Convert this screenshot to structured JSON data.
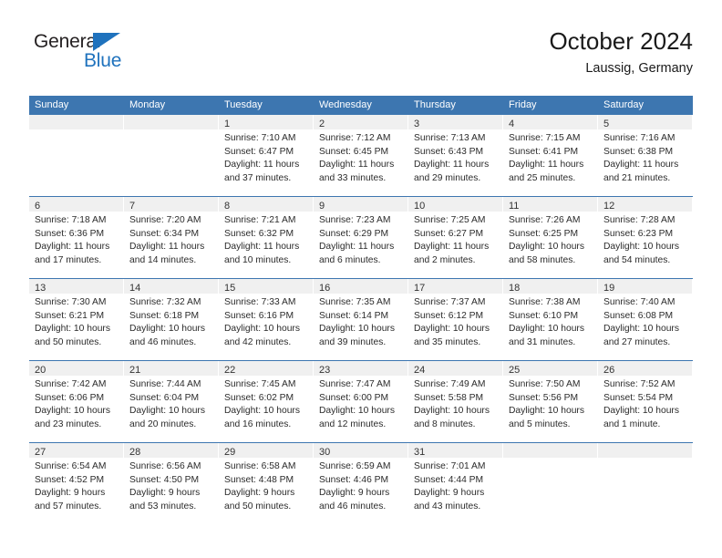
{
  "logo": {
    "word_top": "General",
    "word_bottom": "Blue",
    "triangle_color": "#1f72bd",
    "text_color": "#231f20"
  },
  "header": {
    "title": "October 2024",
    "subtitle": "Laussig, Germany"
  },
  "theme": {
    "header_bar": "#3d76b0",
    "num_band": "#f0f0f0",
    "text": "#2b2b2b"
  },
  "calendar": {
    "day_headers": [
      "Sunday",
      "Monday",
      "Tuesday",
      "Wednesday",
      "Thursday",
      "Friday",
      "Saturday"
    ],
    "weeks": [
      [
        {
          "day": "",
          "lines": []
        },
        {
          "day": "",
          "lines": []
        },
        {
          "day": "1",
          "lines": [
            "Sunrise: 7:10 AM",
            "Sunset: 6:47 PM",
            "Daylight: 11 hours",
            "and 37 minutes."
          ]
        },
        {
          "day": "2",
          "lines": [
            "Sunrise: 7:12 AM",
            "Sunset: 6:45 PM",
            "Daylight: 11 hours",
            "and 33 minutes."
          ]
        },
        {
          "day": "3",
          "lines": [
            "Sunrise: 7:13 AM",
            "Sunset: 6:43 PM",
            "Daylight: 11 hours",
            "and 29 minutes."
          ]
        },
        {
          "day": "4",
          "lines": [
            "Sunrise: 7:15 AM",
            "Sunset: 6:41 PM",
            "Daylight: 11 hours",
            "and 25 minutes."
          ]
        },
        {
          "day": "5",
          "lines": [
            "Sunrise: 7:16 AM",
            "Sunset: 6:38 PM",
            "Daylight: 11 hours",
            "and 21 minutes."
          ]
        }
      ],
      [
        {
          "day": "6",
          "lines": [
            "Sunrise: 7:18 AM",
            "Sunset: 6:36 PM",
            "Daylight: 11 hours",
            "and 17 minutes."
          ]
        },
        {
          "day": "7",
          "lines": [
            "Sunrise: 7:20 AM",
            "Sunset: 6:34 PM",
            "Daylight: 11 hours",
            "and 14 minutes."
          ]
        },
        {
          "day": "8",
          "lines": [
            "Sunrise: 7:21 AM",
            "Sunset: 6:32 PM",
            "Daylight: 11 hours",
            "and 10 minutes."
          ]
        },
        {
          "day": "9",
          "lines": [
            "Sunrise: 7:23 AM",
            "Sunset: 6:29 PM",
            "Daylight: 11 hours",
            "and 6 minutes."
          ]
        },
        {
          "day": "10",
          "lines": [
            "Sunrise: 7:25 AM",
            "Sunset: 6:27 PM",
            "Daylight: 11 hours",
            "and 2 minutes."
          ]
        },
        {
          "day": "11",
          "lines": [
            "Sunrise: 7:26 AM",
            "Sunset: 6:25 PM",
            "Daylight: 10 hours",
            "and 58 minutes."
          ]
        },
        {
          "day": "12",
          "lines": [
            "Sunrise: 7:28 AM",
            "Sunset: 6:23 PM",
            "Daylight: 10 hours",
            "and 54 minutes."
          ]
        }
      ],
      [
        {
          "day": "13",
          "lines": [
            "Sunrise: 7:30 AM",
            "Sunset: 6:21 PM",
            "Daylight: 10 hours",
            "and 50 minutes."
          ]
        },
        {
          "day": "14",
          "lines": [
            "Sunrise: 7:32 AM",
            "Sunset: 6:18 PM",
            "Daylight: 10 hours",
            "and 46 minutes."
          ]
        },
        {
          "day": "15",
          "lines": [
            "Sunrise: 7:33 AM",
            "Sunset: 6:16 PM",
            "Daylight: 10 hours",
            "and 42 minutes."
          ]
        },
        {
          "day": "16",
          "lines": [
            "Sunrise: 7:35 AM",
            "Sunset: 6:14 PM",
            "Daylight: 10 hours",
            "and 39 minutes."
          ]
        },
        {
          "day": "17",
          "lines": [
            "Sunrise: 7:37 AM",
            "Sunset: 6:12 PM",
            "Daylight: 10 hours",
            "and 35 minutes."
          ]
        },
        {
          "day": "18",
          "lines": [
            "Sunrise: 7:38 AM",
            "Sunset: 6:10 PM",
            "Daylight: 10 hours",
            "and 31 minutes."
          ]
        },
        {
          "day": "19",
          "lines": [
            "Sunrise: 7:40 AM",
            "Sunset: 6:08 PM",
            "Daylight: 10 hours",
            "and 27 minutes."
          ]
        }
      ],
      [
        {
          "day": "20",
          "lines": [
            "Sunrise: 7:42 AM",
            "Sunset: 6:06 PM",
            "Daylight: 10 hours",
            "and 23 minutes."
          ]
        },
        {
          "day": "21",
          "lines": [
            "Sunrise: 7:44 AM",
            "Sunset: 6:04 PM",
            "Daylight: 10 hours",
            "and 20 minutes."
          ]
        },
        {
          "day": "22",
          "lines": [
            "Sunrise: 7:45 AM",
            "Sunset: 6:02 PM",
            "Daylight: 10 hours",
            "and 16 minutes."
          ]
        },
        {
          "day": "23",
          "lines": [
            "Sunrise: 7:47 AM",
            "Sunset: 6:00 PM",
            "Daylight: 10 hours",
            "and 12 minutes."
          ]
        },
        {
          "day": "24",
          "lines": [
            "Sunrise: 7:49 AM",
            "Sunset: 5:58 PM",
            "Daylight: 10 hours",
            "and 8 minutes."
          ]
        },
        {
          "day": "25",
          "lines": [
            "Sunrise: 7:50 AM",
            "Sunset: 5:56 PM",
            "Daylight: 10 hours",
            "and 5 minutes."
          ]
        },
        {
          "day": "26",
          "lines": [
            "Sunrise: 7:52 AM",
            "Sunset: 5:54 PM",
            "Daylight: 10 hours",
            "and 1 minute."
          ]
        }
      ],
      [
        {
          "day": "27",
          "lines": [
            "Sunrise: 6:54 AM",
            "Sunset: 4:52 PM",
            "Daylight: 9 hours",
            "and 57 minutes."
          ]
        },
        {
          "day": "28",
          "lines": [
            "Sunrise: 6:56 AM",
            "Sunset: 4:50 PM",
            "Daylight: 9 hours",
            "and 53 minutes."
          ]
        },
        {
          "day": "29",
          "lines": [
            "Sunrise: 6:58 AM",
            "Sunset: 4:48 PM",
            "Daylight: 9 hours",
            "and 50 minutes."
          ]
        },
        {
          "day": "30",
          "lines": [
            "Sunrise: 6:59 AM",
            "Sunset: 4:46 PM",
            "Daylight: 9 hours",
            "and 46 minutes."
          ]
        },
        {
          "day": "31",
          "lines": [
            "Sunrise: 7:01 AM",
            "Sunset: 4:44 PM",
            "Daylight: 9 hours",
            "and 43 minutes."
          ]
        },
        {
          "day": "",
          "lines": []
        },
        {
          "day": "",
          "lines": []
        }
      ]
    ]
  }
}
